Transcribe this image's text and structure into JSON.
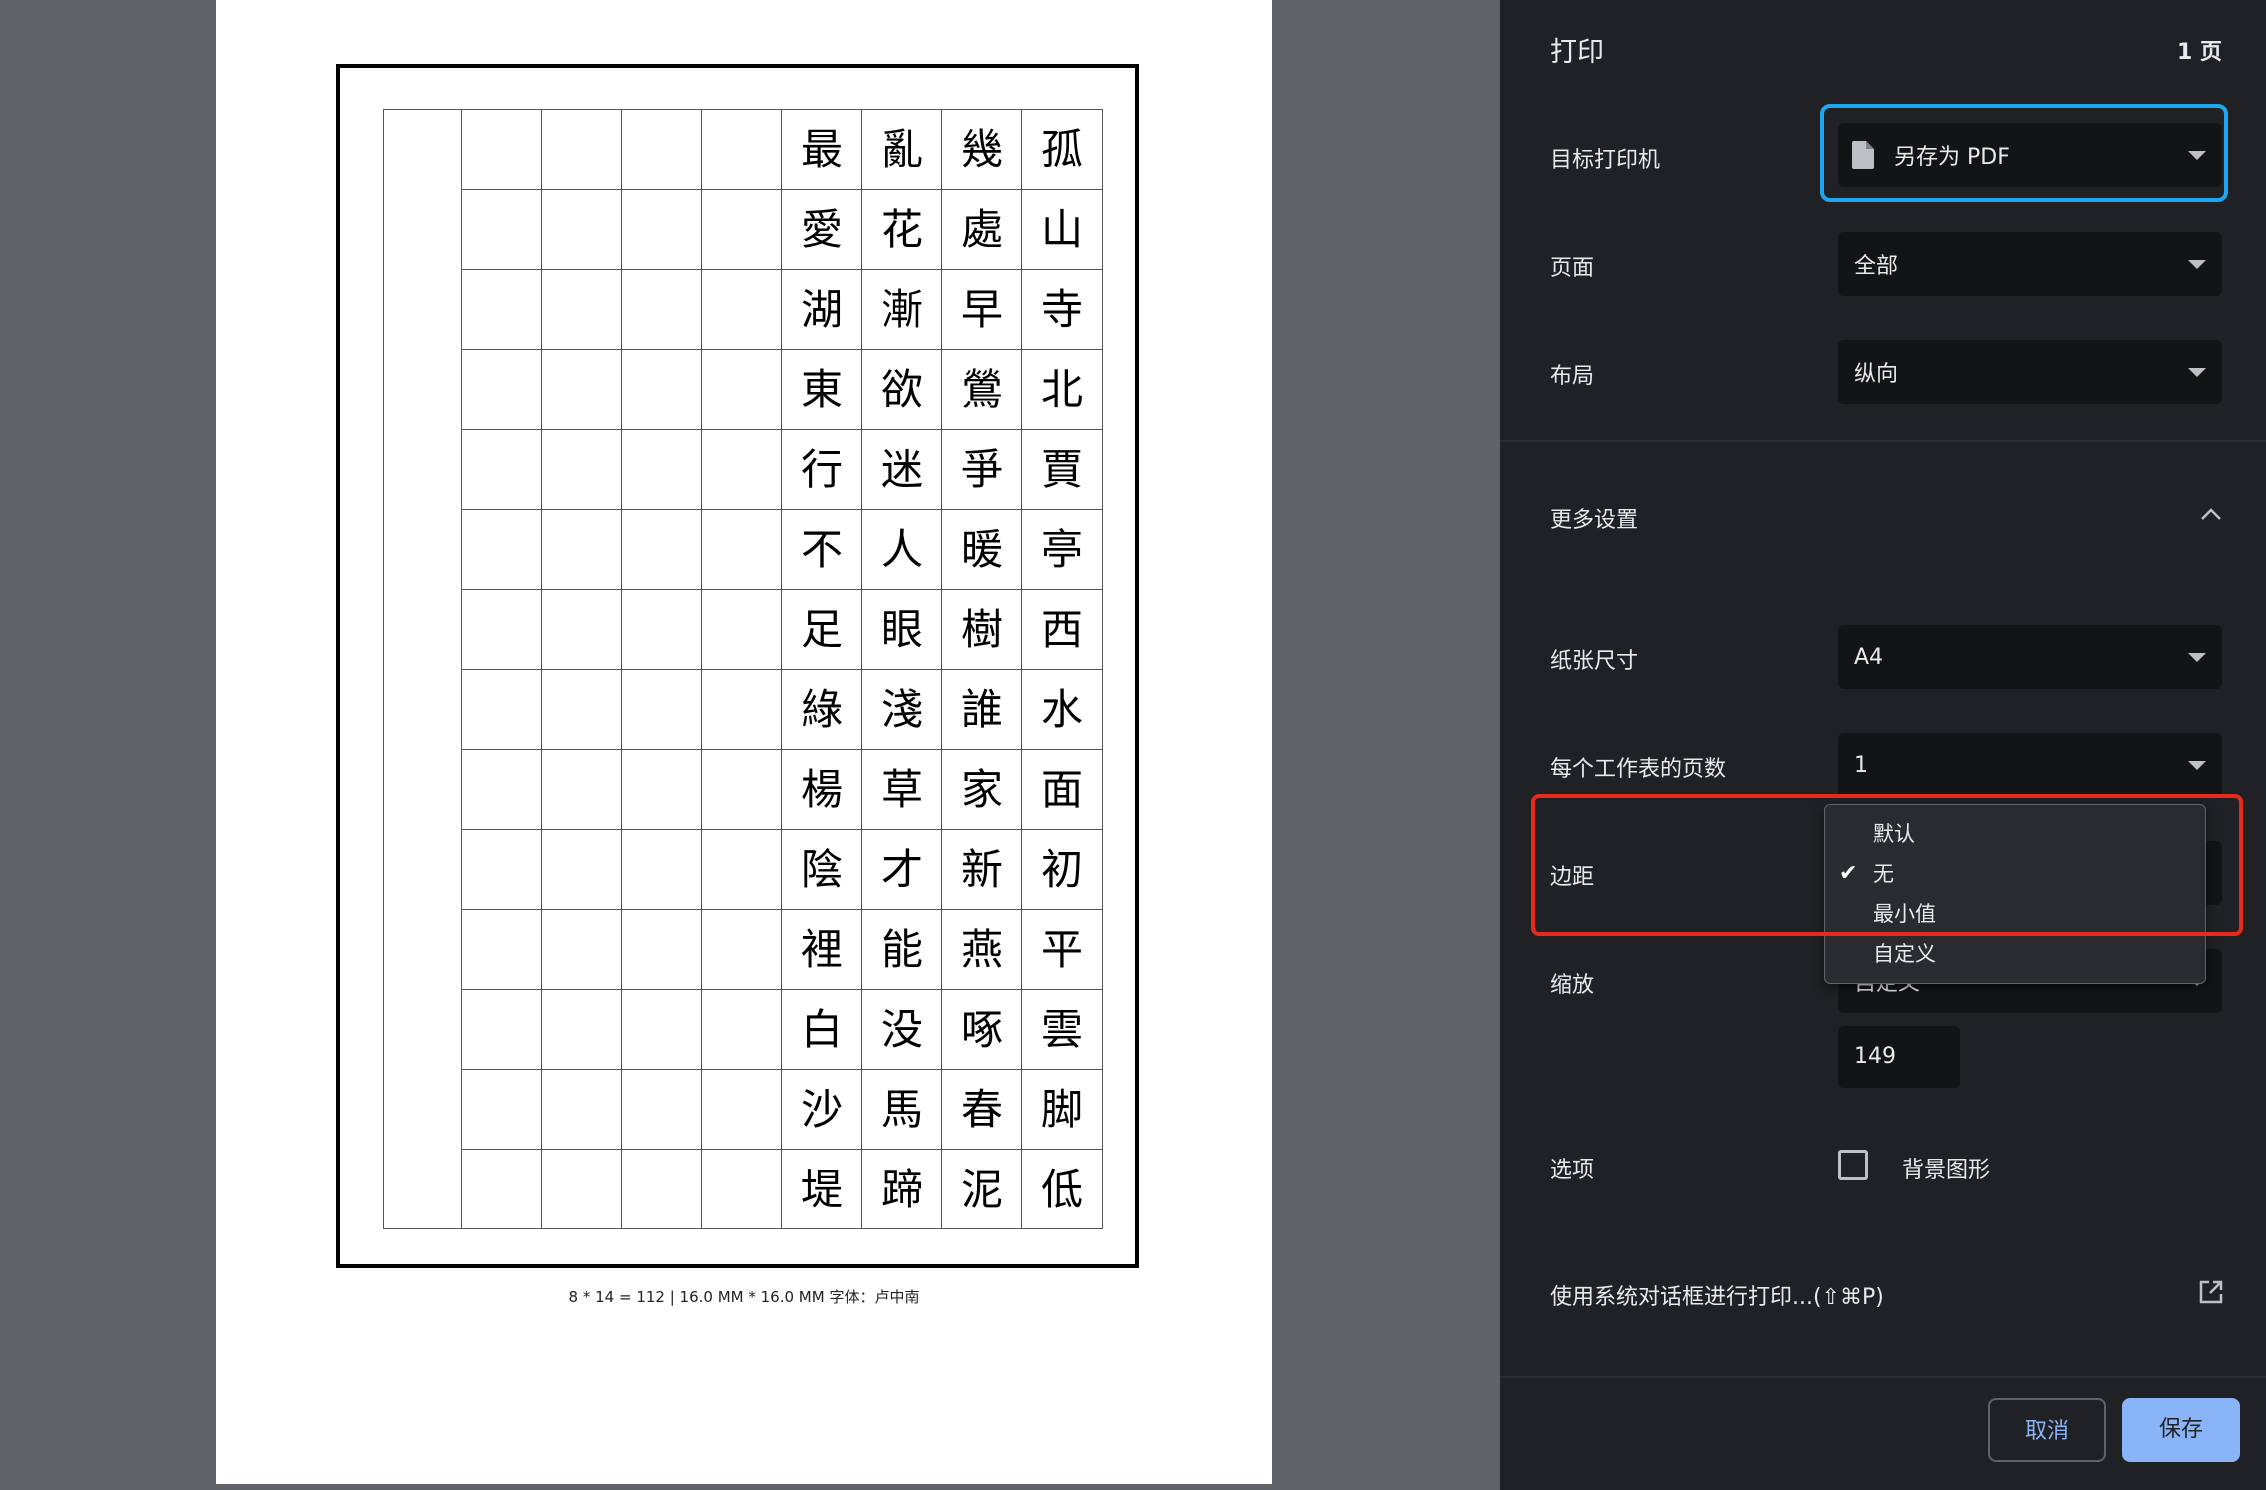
{
  "preview": {
    "columns": [
      [
        "孤",
        "山",
        "寺",
        "北",
        "賈",
        "亭",
        "西",
        "水",
        "面",
        "初",
        "平",
        "雲",
        "脚",
        "低"
      ],
      [
        "幾",
        "處",
        "早",
        "鶯",
        "爭",
        "暖",
        "樹",
        "誰",
        "家",
        "新",
        "燕",
        "啄",
        "春",
        "泥"
      ],
      [
        "亂",
        "花",
        "漸",
        "欲",
        "迷",
        "人",
        "眼",
        "淺",
        "草",
        "才",
        "能",
        "没",
        "馬",
        "蹄"
      ],
      [
        "最",
        "愛",
        "湖",
        "東",
        "行",
        "不",
        "足",
        "綠",
        "楊",
        "陰",
        "裡",
        "白",
        "沙",
        "堤"
      ]
    ],
    "caption": "8 * 14 = 112 | 16.0 MM * 16.0 MM   字体：卢中南"
  },
  "panel": {
    "title": "打印",
    "page_count": "1 页",
    "destination": {
      "label": "目标打印机",
      "value": "另存为 PDF",
      "icon": "pdf-file-icon"
    },
    "pages": {
      "label": "页面",
      "value": "全部"
    },
    "layout": {
      "label": "布局",
      "value": "纵向"
    },
    "more_settings": {
      "label": "更多设置",
      "icon": "chevron-up-icon"
    },
    "paper_size": {
      "label": "纸张尺寸",
      "value": "A4"
    },
    "pages_per_sheet": {
      "label": "每个工作表的页数",
      "value": "1"
    },
    "margins": {
      "label": "边距",
      "options": [
        "默认",
        "无",
        "最小值",
        "自定义"
      ],
      "selected": "无"
    },
    "scale": {
      "label": "缩放",
      "value": "自定义",
      "input_value": "149"
    },
    "options": {
      "label": "选项",
      "background_graphics": "背景图形",
      "checked": false
    },
    "system_dialog": {
      "label": "使用系统对话框进行打印...(⇧⌘P)",
      "icon": "open-external-icon"
    },
    "buttons": {
      "cancel": "取消",
      "save": "保存"
    }
  },
  "colors": {
    "panel_bg": "#202124",
    "accent_blue": "#8ab4f8",
    "highlight_blue": "#1ea7ef",
    "highlight_red": "#e8291c"
  }
}
